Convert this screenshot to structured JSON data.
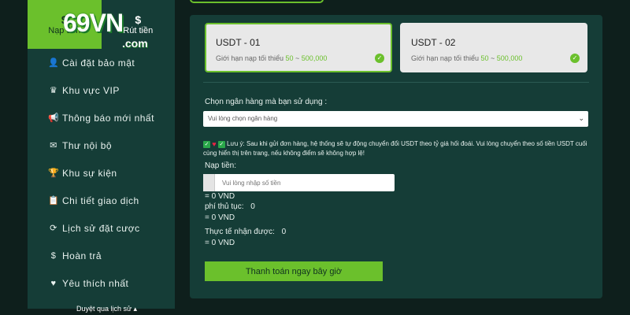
{
  "sidebar": {
    "tabs": [
      {
        "icon": "$",
        "label": "Nạp tiền",
        "active": true
      },
      {
        "icon": "$",
        "label": "Rút tiền",
        "active": false
      }
    ],
    "logo": {
      "text": "69VN",
      "sub": ".com"
    },
    "items": [
      {
        "icon": "user-lock-icon",
        "glyph": "👤",
        "label": "Cài đặt bảo mật"
      },
      {
        "icon": "crown-icon",
        "glyph": "♛",
        "label": "Khu vực VIP"
      },
      {
        "icon": "megaphone-icon",
        "glyph": "📢",
        "label": "Thông báo mới nhất"
      },
      {
        "icon": "envelope-icon",
        "glyph": "✉",
        "label": "Thư nội bộ"
      },
      {
        "icon": "trophy-icon",
        "glyph": "🏆",
        "label": "Khu sự kiện"
      },
      {
        "icon": "clipboard-icon",
        "glyph": "📋",
        "label": "Chi tiết giao dịch"
      },
      {
        "icon": "history-icon",
        "glyph": "⟳",
        "label": "Lịch sử đặt cược"
      },
      {
        "icon": "dollar-circle-icon",
        "glyph": "$",
        "label": "Hoàn trả"
      },
      {
        "icon": "heart-icon",
        "glyph": "♥",
        "label": "Yêu thích nhất"
      }
    ],
    "history_link": "Duyệt qua lịch sử ▴"
  },
  "deposit": {
    "options": [
      {
        "title": "USDT - 01",
        "limit_label": "Giới hạn nạp tối thiểu",
        "min": "50",
        "sep": "~",
        "max": "500,000",
        "selected": true
      },
      {
        "title": "USDT - 02",
        "limit_label": "Giới hạn nạp tối thiểu",
        "min": "50",
        "sep": "~",
        "max": "500,000",
        "selected": false
      }
    ],
    "bank_label": "Chọn ngân hàng mà bạn sử dụng :",
    "bank_select": "Vui lòng chọn ngân hàng",
    "note_label": "Lưu ý:",
    "note_text": "Sau khi gửi đơn hàng, hệ thống sẽ tự động chuyển đổi USDT theo tỷ giá hối đoái. Vui lòng chuyển theo số tiền USDT cuối cùng hiển thị trên trang, nếu không điểm sẽ không hợp lệ!",
    "amount_label": "Nạp tiền:",
    "amount_placeholder": "Vui lòng nhập số tiền",
    "amount_equiv": "= 0 VND",
    "fee_label": "phí thủ tục:",
    "fee_value": "0",
    "fee_equiv": "= 0 VND",
    "actual_label": "Thực tế nhận được:",
    "actual_value": "0",
    "actual_equiv": "= 0 VND",
    "submit_label": "Thanh toán ngay bây giờ"
  },
  "colors": {
    "accent": "#6bc02c",
    "panel": "#153d37",
    "background": "#0e1f1c"
  }
}
